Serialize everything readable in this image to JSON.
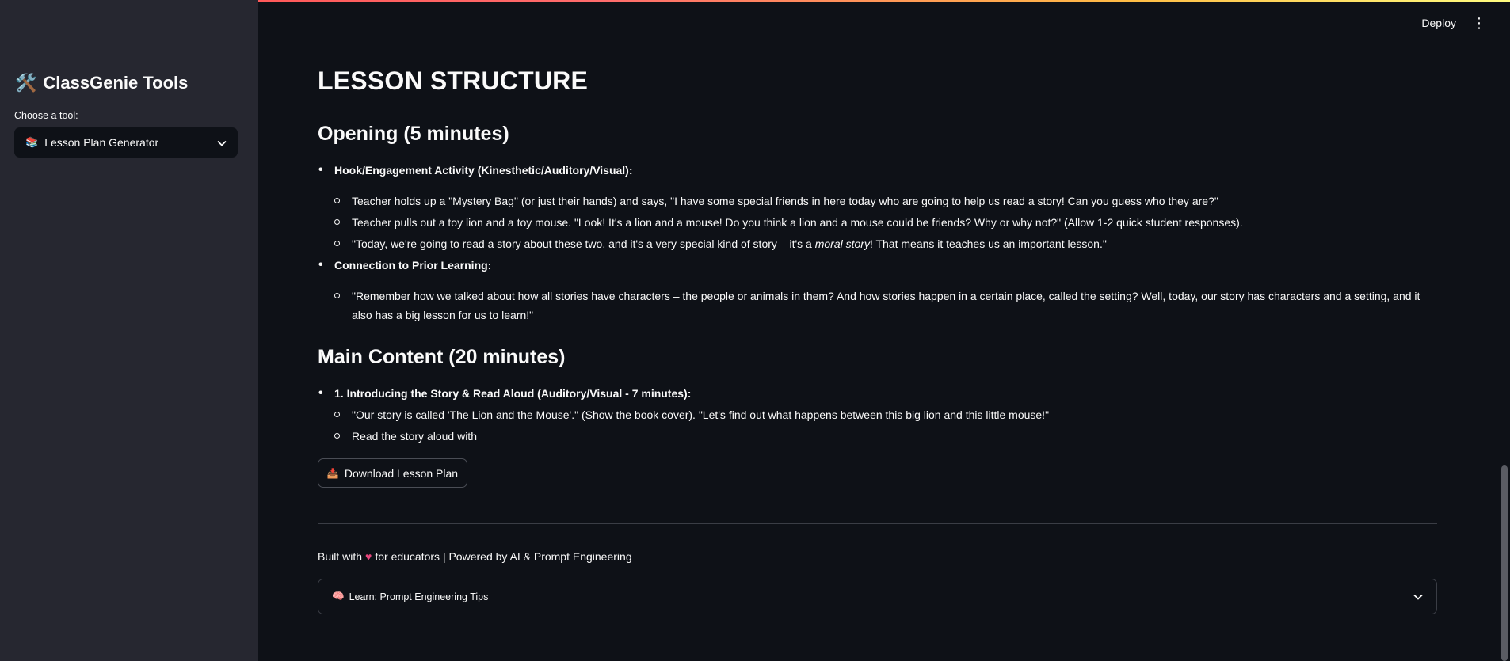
{
  "sidebar": {
    "title_icon": "tools-emoji-icon",
    "title": "ClassGenie Tools",
    "tool_label": "Choose a tool:",
    "tool_icon": "books-emoji-icon",
    "tool_selected": "Lesson Plan Generator"
  },
  "header": {
    "deploy_label": "Deploy"
  },
  "content": {
    "title": "LESSON STRUCTURE",
    "opening": {
      "heading": "Opening (5 minutes)",
      "hook_label": "Hook/Engagement Activity (Kinesthetic/Auditory/Visual):",
      "hook_items": [
        "Teacher holds up a \"Mystery Bag\" (or just their hands) and says, \"I have some special friends in here today who are going to help us read a story! Can you guess who they are?\"",
        "Teacher pulls out a toy lion and a toy mouse. \"Look! It's a lion and a mouse! Do you think a lion and a mouse could be friends? Why or why not?\" (Allow 1-2 quick student responses)."
      ],
      "hook_item3_before": "\"Today, we're going to read a story about these two, and it's a very special kind of story – it's a ",
      "hook_item3_em": "moral story",
      "hook_item3_after": "! That means it teaches us an important lesson.\"",
      "prior_label": "Connection to Prior Learning:",
      "prior_item": "\"Remember how we talked about how all stories have characters – the people or animals in them? And how stories happen in a certain place, called the setting? Well, today, our story has characters and a setting, and it also has a big lesson for us to learn!\""
    },
    "main": {
      "heading": "Main Content (20 minutes)",
      "step1_label": "1. Introducing the Story & Read Aloud (Auditory/Visual - 7 minutes):",
      "step1_items": [
        "\"Our story is called 'The Lion and the Mouse'.\" (Show the book cover). \"Let's find out what happens between this big lion and this little mouse!\"",
        "Read the story aloud with"
      ]
    },
    "download_label": "Download Lesson Plan",
    "download_icon": "inbox-tray-icon"
  },
  "footer": {
    "before_heart": "Built with",
    "after_heart": "for educators | Powered by AI & Prompt Engineering",
    "heart_icon": "heart-icon",
    "expander_label": "Learn: Prompt Engineering Tips",
    "expander_icon": "brain-icon"
  }
}
